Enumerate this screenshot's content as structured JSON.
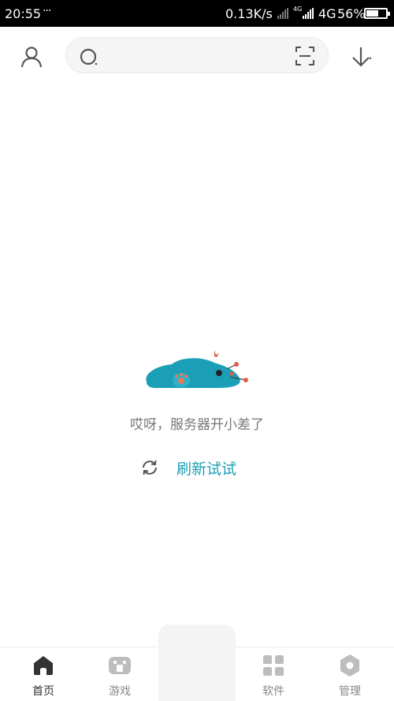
{
  "status_bar": {
    "time": "20:55",
    "notification_dots": "···",
    "net_speed": "0.13K/s",
    "sim1_tag": "4G",
    "network": "4G",
    "battery_percent": "56%",
    "battery_level": 0.56
  },
  "header": {
    "user_icon": "user-icon",
    "search_icon": "search-icon",
    "scan_icon": "scan-icon",
    "download_icon": "download-icon"
  },
  "empty_state": {
    "message": "哎呀，服务器开小差了",
    "retry_label": "刷新试试",
    "illustration": "sleeping-creature-illustration",
    "accent_color": "#1aa0b4"
  },
  "bottom_nav": {
    "items": [
      {
        "label": "首页",
        "icon": "home-icon",
        "active": true
      },
      {
        "label": "游戏",
        "icon": "gamepad-icon",
        "active": false
      },
      {
        "label": "软件",
        "icon": "apps-grid-icon",
        "active": false
      },
      {
        "label": "管理",
        "icon": "hexagon-icon",
        "active": false
      }
    ]
  }
}
